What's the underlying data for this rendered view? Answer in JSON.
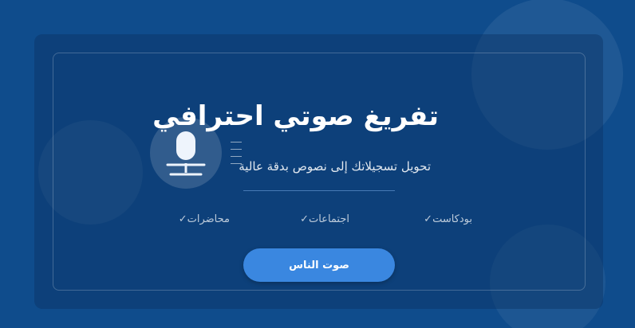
{
  "hero": {
    "title": "تفريغ صوتي احترافي",
    "subtitle": "تحويل تسجيلاتك إلى نصوص بدقة عالية"
  },
  "features": [
    {
      "label": "بودكاست",
      "icon": "check-icon"
    },
    {
      "label": "اجتماعات",
      "icon": "check-icon"
    },
    {
      "label": "محاضرات",
      "icon": "check-icon"
    }
  ],
  "cta": {
    "label": "صوت الناس"
  },
  "icons": {
    "main": "microphone-icon",
    "check_glyph": "✓"
  },
  "colors": {
    "background": "#0f4c8c",
    "accent": "#3a87e0",
    "text": "#ffffff"
  }
}
